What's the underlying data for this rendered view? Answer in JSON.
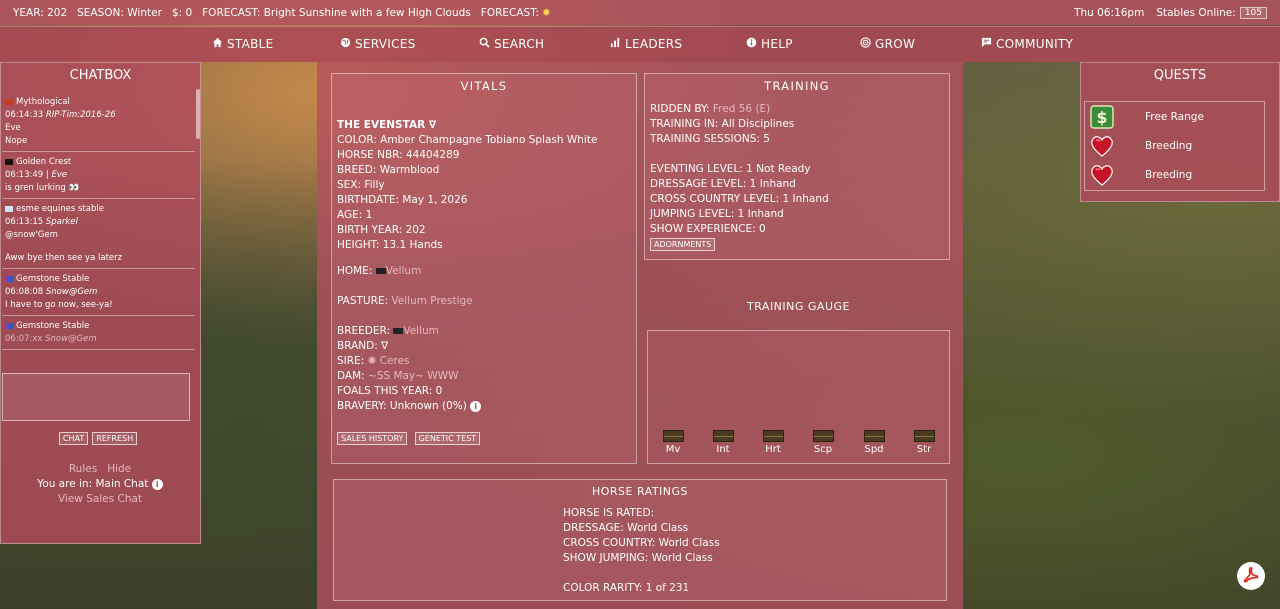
{
  "topbar": {
    "year": "YEAR: 202",
    "season": "SEASON: Winter",
    "money": "$: 0",
    "forecast": "FORECAST: Bright Sunshine with a few High Clouds",
    "forecast2": "FORECAST:",
    "time": "Thu 06:16pm",
    "stables_online_label": "Stables Online:",
    "stables_online_count": "105"
  },
  "nav": {
    "items": [
      {
        "label": "STABLE",
        "icon": "home-icon"
      },
      {
        "label": "SERVICES",
        "icon": "globe-icon"
      },
      {
        "label": "SEARCH",
        "icon": "search-icon"
      },
      {
        "label": "LEADERS",
        "icon": "bar-chart-icon"
      },
      {
        "label": "HELP",
        "icon": "info-icon"
      },
      {
        "label": "GROW",
        "icon": "target-icon"
      },
      {
        "label": "COMMUNITY",
        "icon": "chat-icon"
      }
    ]
  },
  "chatbox": {
    "title": "CHATBOX",
    "messages": [
      {
        "stable": "Mythological",
        "time": "06:14:33",
        "author": "RIP-Tim:2016-26",
        "name": "Eve",
        "text": "Nope",
        "swatch": "#c04020"
      },
      {
        "stable": "Golden Crest",
        "time": "06:13:49",
        "author": "Eve",
        "text": "is gren lurking 👀",
        "swatch": "#111111"
      },
      {
        "stable": "esme equines stable",
        "time": "06:13:15",
        "author": "Sparkel",
        "text": "@snow'Gem",
        "text2": "Aww bye then see ya laterz",
        "swatch": "#cfe3f5"
      },
      {
        "stable": "Gemstone Stable",
        "time": "06:08:08",
        "author": "Snow@Gem",
        "text": "I have to go now, see-ya!",
        "swatch": "#7a40c0"
      },
      {
        "stable": "Gemstone Stable",
        "time": "06:07:xx",
        "author": "Snow@Gem",
        "swatch": "#7a40c0"
      }
    ],
    "chat_btn": "CHAT",
    "refresh_btn": "REFRESH",
    "rules": "Rules",
    "hide": "Hide",
    "you_are_in": "You are in: Main Chat",
    "view_sales": "View Sales Chat"
  },
  "vitals": {
    "title": "VITALS",
    "name": "THE EVENSTAR ∇",
    "color": "COLOR: Amber Champagne Tobiano Splash White",
    "horse_nbr": "HORSE NBR: 44404289",
    "breed": "BREED: Warmblood",
    "sex": "SEX: Filly",
    "birthdate": "BIRTHDATE: May 1, 2026",
    "age": "AGE: 1",
    "birth_year": "BIRTH YEAR: 202",
    "height": "HEIGHT: 13.1 Hands",
    "home_label": "HOME:",
    "home_value": "Vellum",
    "pasture_label": "PASTURE:",
    "pasture_value": "Vellum Prestige",
    "breeder_label": "BREEDER:",
    "breeder_value": "Vellum",
    "brand": "BRAND: ∇",
    "sire_label": "SIRE:",
    "sire_value": "✺ Ceres",
    "dam_label": "DAM:",
    "dam_value": "~SS May~ WWW",
    "foals": "FOALS THIS YEAR: 0",
    "bravery": "BRAVERY: Unknown (0%)",
    "sales_history_btn": "SALES HISTORY",
    "genetic_test_btn": "GENETIC TEST"
  },
  "training": {
    "title": "TRAINING",
    "ridden_label": "RIDDEN BY:",
    "ridden_value": "Fred 56 (E)",
    "training_in": "TRAINING IN: All Disciplines",
    "sessions": "TRAINING SESSIONS: 5",
    "eventing": "EVENTING LEVEL: 1 Not Ready",
    "dressage": "DRESSAGE LEVEL: 1 Inhand",
    "cross_country": "CROSS COUNTRY LEVEL: 1 Inhand",
    "jumping": "JUMPING LEVEL: 1 Inhand",
    "show_exp": "SHOW EXPERIENCE: 0",
    "adornments_btn": "ADORNMENTS"
  },
  "gauge": {
    "title": "TRAINING GAUGE",
    "labels": [
      "Mv",
      "Int",
      "Hrt",
      "Scp",
      "Spd",
      "Str"
    ]
  },
  "ratings": {
    "title": "HORSE RATINGS",
    "rated": "HORSE IS RATED:",
    "dressage": "DRESSAGE: World Class",
    "cross_country": "CROSS COUNTRY: World Class",
    "show_jumping": "SHOW JUMPING: World Class",
    "color_rarity": "COLOR RARITY: 1 of 231"
  },
  "quests": {
    "title": "QUESTS",
    "items": [
      {
        "label": "Free Range",
        "icon": "dollar-icon"
      },
      {
        "label": "Breeding",
        "icon": "heart-icon"
      },
      {
        "label": "Breeding",
        "icon": "heart-icon"
      }
    ]
  },
  "colors": {
    "accent": "#b04a5a",
    "sun": "#ffd94a"
  }
}
